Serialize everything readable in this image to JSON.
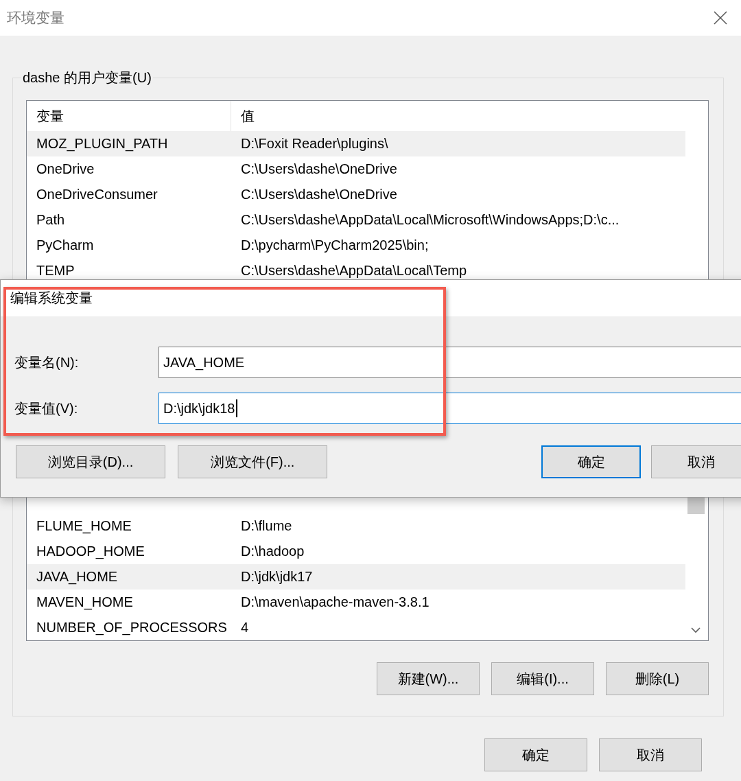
{
  "window": {
    "title": "环境变量"
  },
  "user_variables": {
    "label": "dashe 的用户变量(U)",
    "columns": [
      "变量",
      "值"
    ],
    "rows": [
      {
        "name": "MOZ_PLUGIN_PATH",
        "value": "D:\\Foxit Reader\\plugins\\",
        "selected": true
      },
      {
        "name": "OneDrive",
        "value": "C:\\Users\\dashe\\OneDrive",
        "selected": false
      },
      {
        "name": "OneDriveConsumer",
        "value": "C:\\Users\\dashe\\OneDrive",
        "selected": false
      },
      {
        "name": "Path",
        "value": "C:\\Users\\dashe\\AppData\\Local\\Microsoft\\WindowsApps;D:\\c...",
        "selected": false
      },
      {
        "name": "PyCharm",
        "value": "D:\\pycharm\\PyCharm2025\\bin;",
        "selected": false
      },
      {
        "name": "TEMP",
        "value": "C:\\Users\\dashe\\AppData\\Local\\Temp",
        "selected": false
      }
    ]
  },
  "system_variables": {
    "rows": [
      {
        "name": "FLUME_HOME",
        "value": "D:\\flume",
        "selected": false
      },
      {
        "name": "HADOOP_HOME",
        "value": "D:\\hadoop",
        "selected": false
      },
      {
        "name": "JAVA_HOME",
        "value": "D:\\jdk\\jdk17",
        "selected": true
      },
      {
        "name": "MAVEN_HOME",
        "value": "D:\\maven\\apache-maven-3.8.1",
        "selected": false
      },
      {
        "name": "NUMBER_OF_PROCESSORS",
        "value": "4",
        "selected": false
      }
    ],
    "buttons": [
      "新建(W)...",
      "编辑(I)...",
      "删除(L)"
    ]
  },
  "buttons": [
    "确定",
    "取消"
  ],
  "edit_dialog": {
    "title": "编辑系统变量",
    "fields": [
      {
        "label": "变量名(N):",
        "value": "JAVA_HOME",
        "focused": false
      },
      {
        "label": "变量值(V):",
        "value": "D:\\jdk\\jdk18",
        "focused": true
      }
    ],
    "buttons": [
      {
        "label": "浏览目录(D)...",
        "default": false
      },
      {
        "label": "浏览文件(F)...",
        "default": false
      },
      {
        "label": "确定",
        "default": true
      },
      {
        "label": "取消",
        "default": false
      }
    ]
  }
}
